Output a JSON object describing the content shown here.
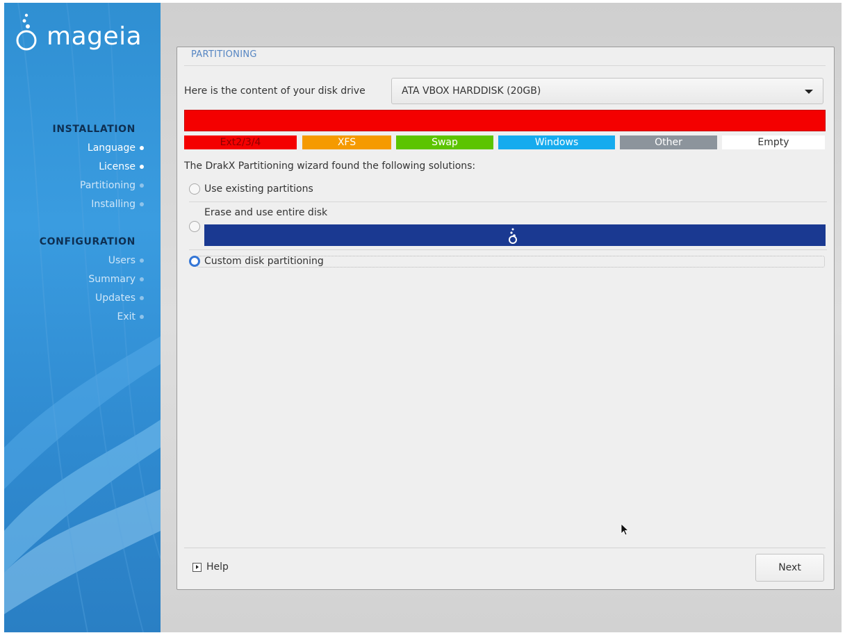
{
  "brand": {
    "logo_text": "mageia"
  },
  "sidebar": {
    "installation_title": "INSTALLATION",
    "installation_steps": [
      {
        "label": "Language",
        "done": true
      },
      {
        "label": "License",
        "done": true
      },
      {
        "label": "Partitioning",
        "done": false
      },
      {
        "label": "Installing",
        "done": false
      }
    ],
    "configuration_title": "CONFIGURATION",
    "configuration_steps": [
      {
        "label": "Users",
        "done": false
      },
      {
        "label": "Summary",
        "done": false
      },
      {
        "label": "Updates",
        "done": false
      },
      {
        "label": "Exit",
        "done": false
      }
    ]
  },
  "panel": {
    "title": "PARTITIONING",
    "disk_label": "Here is the content of your disk drive",
    "disk_selected": "ATA VBOX HARDDISK (20GB)",
    "legend": [
      {
        "label": "Ext2/3/4",
        "color": "#f40000",
        "text_color": "#8c0000"
      },
      {
        "label": "XFS",
        "color": "#f59a00",
        "text_color": "#ffffff"
      },
      {
        "label": "Swap",
        "color": "#5cc400",
        "text_color": "#ffffff"
      },
      {
        "label": "Windows",
        "color": "#16abee",
        "text_color": "#ffffff"
      },
      {
        "label": "Other",
        "color": "#8c949c",
        "text_color": "#ffffff"
      },
      {
        "label": "Empty",
        "color": "#ffffff",
        "text_color": "#333333"
      }
    ],
    "intro": "The DrakX Partitioning wizard found the following solutions:",
    "options": {
      "existing": "Use existing partitions",
      "erase": "Erase and use entire disk",
      "custom": "Custom disk partitioning"
    },
    "selected_option": "custom",
    "help_label": "Help",
    "next_label": "Next"
  },
  "colors": {
    "sidebar_blue": "#2f8fd2",
    "accent": "#3476d6",
    "erase_bar": "#1a3991",
    "used_partition": "#f40000"
  }
}
